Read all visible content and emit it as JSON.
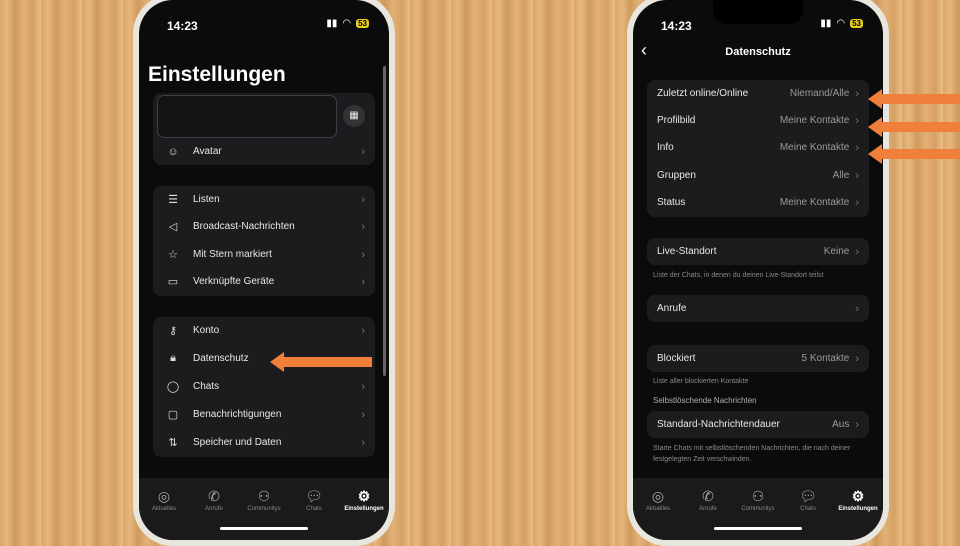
{
  "status": {
    "time": "14:23",
    "battery": "53"
  },
  "left": {
    "title": "Einstellungen",
    "avatar": "Avatar",
    "group2": [
      {
        "icon": "list-icon",
        "label": "Listen"
      },
      {
        "icon": "megaphone-icon",
        "label": "Broadcast-Nachrichten"
      },
      {
        "icon": "star-icon",
        "label": "Mit Stern markiert"
      },
      {
        "icon": "laptop-icon",
        "label": "Verknüpfte Geräte"
      }
    ],
    "group3": [
      {
        "icon": "key-icon",
        "label": "Konto"
      },
      {
        "icon": "lock-icon",
        "label": "Datenschutz"
      },
      {
        "icon": "chat-icon",
        "label": "Chats"
      },
      {
        "icon": "bell-icon",
        "label": "Benachrichtigungen"
      },
      {
        "icon": "transfer-icon",
        "label": "Speicher und Daten"
      }
    ]
  },
  "right": {
    "title": "Datenschutz",
    "group1": [
      {
        "label": "Zuletzt online/Online",
        "value": "Niemand/Alle"
      },
      {
        "label": "Profilbild",
        "value": "Meine Kontakte"
      },
      {
        "label": "Info",
        "value": "Meine Kontakte"
      },
      {
        "label": "Gruppen",
        "value": "Alle"
      },
      {
        "label": "Status",
        "value": "Meine Kontakte"
      }
    ],
    "live": {
      "label": "Live-Standort",
      "value": "Keine",
      "caption": "Liste der Chats, in denen du deinen Live-Standort teilst"
    },
    "calls": {
      "label": "Anrufe"
    },
    "blocked": {
      "label": "Blockiert",
      "value": "5 Kontakte",
      "caption": "Liste aller blockierten Kontakte"
    },
    "section": "Selbstlöschende Nachrichten",
    "timer": {
      "label": "Standard-Nachrichtendauer",
      "value": "Aus",
      "caption": "Starte Chats mit selbstlöschenden Nachrichten, die nach deiner festgelegten Zeit verschwinden."
    }
  },
  "tabs": [
    "Aktuelles",
    "Anrufe",
    "Communitys",
    "Chats",
    "Einstellungen"
  ],
  "accent": "#ef7f3a"
}
